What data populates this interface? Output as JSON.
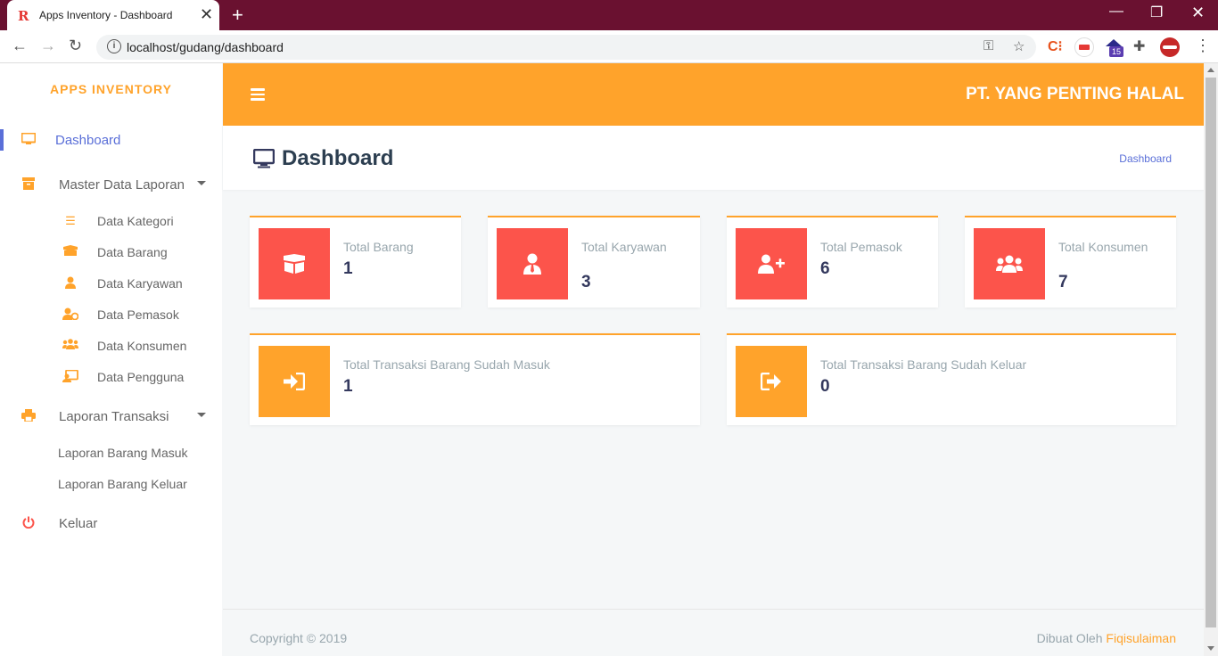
{
  "browser": {
    "tab_title": "Apps Inventory - Dashboard",
    "tab_favicon": "R",
    "url": "localhost/gudang/dashboard",
    "ext_badge": "15"
  },
  "sidebar": {
    "brand": "APPS INVENTORY",
    "items": [
      {
        "label": "Dashboard",
        "icon": "monitor-icon"
      },
      {
        "label": "Master Data Laporan",
        "icon": "archive-icon"
      },
      {
        "label": "Laporan Transaksi",
        "icon": "print-icon"
      },
      {
        "label": "Keluar",
        "icon": "power-icon"
      }
    ],
    "master_sub": [
      {
        "label": "Data Kategori",
        "icon": "list-icon"
      },
      {
        "label": "Data Barang",
        "icon": "box-icon"
      },
      {
        "label": "Data Karyawan",
        "icon": "user-icon"
      },
      {
        "label": "Data Pemasok",
        "icon": "user-cog-icon"
      },
      {
        "label": "Data Konsumen",
        "icon": "users-icon"
      },
      {
        "label": "Data Pengguna",
        "icon": "id-card-icon"
      }
    ],
    "laporan_sub": [
      {
        "label": "Laporan Barang Masuk"
      },
      {
        "label": "Laporan Barang Keluar"
      }
    ]
  },
  "header": {
    "company": "PT. YANG PENTING HALAL"
  },
  "page": {
    "title": "Dashboard",
    "breadcrumb": "Dashboard"
  },
  "cards": [
    {
      "label": "Total Barang",
      "value": "1"
    },
    {
      "label": "Total Karyawan",
      "value": "3"
    },
    {
      "label": "Total Pemasok",
      "value": "6"
    },
    {
      "label": "Total Konsumen",
      "value": "7"
    },
    {
      "label": "Total Transaksi Barang Sudah Masuk",
      "value": "1"
    },
    {
      "label": "Total Transaksi Barang Sudah Keluar",
      "value": "0"
    }
  ],
  "footer": {
    "copyright": "Copyright © 2019",
    "made_by_prefix": "Dibuat Oleh ",
    "made_by_name": "Fiqisulaiman"
  },
  "colors": {
    "accent": "#ffa32b",
    "danger": "#fc544b",
    "primary": "#5a6fd8"
  }
}
